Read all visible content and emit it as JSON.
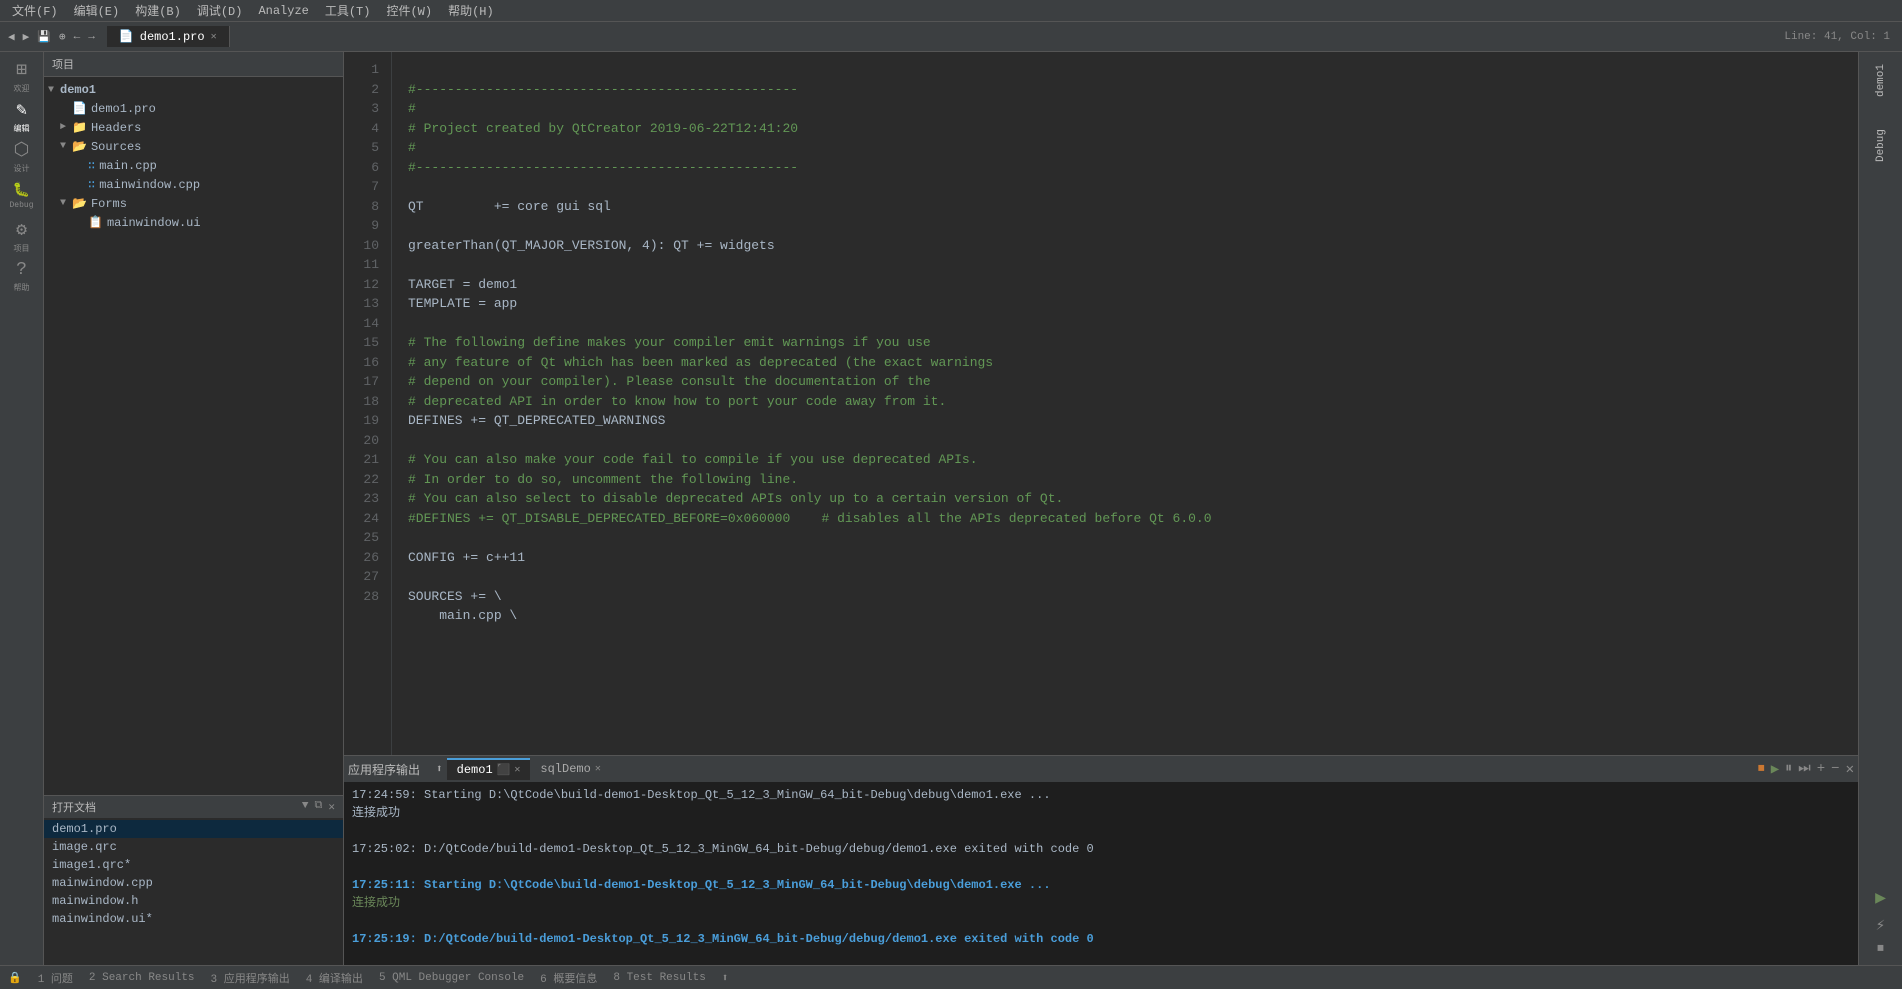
{
  "menuBar": {
    "items": [
      "文件(F)",
      "编辑(E)",
      "构建(B)",
      "调试(D)",
      "Analyze",
      "工具(T)",
      "控件(W)",
      "帮助(H)"
    ]
  },
  "toolbar": {
    "lineCol": "Line: 41, Col: 1"
  },
  "activeTab": {
    "name": "demo1.pro",
    "icon": "📄"
  },
  "projectPanel": {
    "title": "项目",
    "tree": [
      {
        "id": "demo1-root",
        "indent": 0,
        "arrow": "▼",
        "icon": "",
        "name": "demo1",
        "bold": true
      },
      {
        "id": "demo1-pro",
        "indent": 1,
        "arrow": "",
        "icon": "📄",
        "name": "demo1.pro"
      },
      {
        "id": "headers",
        "indent": 1,
        "arrow": "►",
        "icon": "",
        "name": "Headers"
      },
      {
        "id": "sources",
        "indent": 1,
        "arrow": "▼",
        "icon": "",
        "name": "Sources"
      },
      {
        "id": "main-cpp",
        "indent": 2,
        "arrow": "",
        "icon": "📄",
        "name": "main.cpp"
      },
      {
        "id": "mainwindow-cpp",
        "indent": 2,
        "arrow": "",
        "icon": "📄",
        "name": "mainwindow.cpp"
      },
      {
        "id": "forms",
        "indent": 1,
        "arrow": "▼",
        "icon": "",
        "name": "Forms"
      },
      {
        "id": "mainwindow-ui",
        "indent": 2,
        "arrow": "",
        "icon": "📄",
        "name": "mainwindow.ui"
      }
    ]
  },
  "leftSidebar": {
    "items": [
      {
        "id": "welcome",
        "shape": "⊞",
        "label": "欢迎"
      },
      {
        "id": "edit",
        "shape": "✎",
        "label": "编辑",
        "active": true
      },
      {
        "id": "design",
        "shape": "⬡",
        "label": "设计"
      },
      {
        "id": "debug",
        "shape": "🐛",
        "label": "Debug"
      },
      {
        "id": "project",
        "shape": "⚙",
        "label": "项目"
      },
      {
        "id": "help",
        "shape": "?",
        "label": "帮助"
      }
    ]
  },
  "openDocs": {
    "title": "打开文档",
    "items": [
      {
        "name": "demo1.pro"
      },
      {
        "name": "image.qrc"
      },
      {
        "name": "image1.qrc*"
      },
      {
        "name": "mainwindow.cpp"
      },
      {
        "name": "mainwindow.h"
      },
      {
        "name": "mainwindow.ui*"
      }
    ]
  },
  "miniSidebar": {
    "items": [
      {
        "id": "demo1-mini",
        "label": "demo1"
      },
      {
        "id": "debug-mini",
        "label": "Debug"
      }
    ]
  },
  "code": {
    "lines": [
      {
        "num": 1,
        "content": "#-------------------------------------------------",
        "class": "c-comment"
      },
      {
        "num": 2,
        "content": "#",
        "class": "c-comment"
      },
      {
        "num": 3,
        "content": "# Project created by QtCreator 2019-06-22T12:41:20",
        "class": "c-comment"
      },
      {
        "num": 4,
        "content": "#",
        "class": "c-comment"
      },
      {
        "num": 5,
        "content": "#-------------------------------------------------",
        "class": "c-comment"
      },
      {
        "num": 6,
        "content": "",
        "class": ""
      },
      {
        "num": 7,
        "content": "QT         += core gui sql",
        "class": "c-text"
      },
      {
        "num": 8,
        "content": "",
        "class": ""
      },
      {
        "num": 9,
        "content": "greaterThan(QT_MAJOR_VERSION, 4): QT += widgets",
        "class": "c-text"
      },
      {
        "num": 10,
        "content": "",
        "class": ""
      },
      {
        "num": 11,
        "content": "TARGET = demo1",
        "class": "c-text"
      },
      {
        "num": 12,
        "content": "TEMPLATE = app",
        "class": "c-text"
      },
      {
        "num": 13,
        "content": "",
        "class": ""
      },
      {
        "num": 14,
        "content": "# The following define makes your compiler emit warnings if you use",
        "class": "c-comment"
      },
      {
        "num": 15,
        "content": "# any feature of Qt which has been marked as deprecated (the exact warnings",
        "class": "c-comment"
      },
      {
        "num": 16,
        "content": "# depend on your compiler). Please consult the documentation of the",
        "class": "c-comment"
      },
      {
        "num": 17,
        "content": "# deprecated API in order to know how to port your code away from it.",
        "class": "c-comment"
      },
      {
        "num": 18,
        "content": "DEFINES += QT_DEPRECATED_WARNINGS",
        "class": "c-text"
      },
      {
        "num": 19,
        "content": "",
        "class": ""
      },
      {
        "num": 20,
        "content": "# You can also make your code fail to compile if you use deprecated APIs.",
        "class": "c-comment"
      },
      {
        "num": 21,
        "content": "# In order to do so, uncomment the following line.",
        "class": "c-comment"
      },
      {
        "num": 22,
        "content": "# You can also select to disable deprecated APIs only up to a certain version of Qt.",
        "class": "c-comment"
      },
      {
        "num": 23,
        "content": "#DEFINES += QT_DISABLE_DEPRECATED_BEFORE=0x060000    # disables all the APIs deprecated before Qt 6.0.0",
        "class": "c-comment"
      },
      {
        "num": 24,
        "content": "",
        "class": ""
      },
      {
        "num": 25,
        "content": "CONFIG += c++11",
        "class": "c-text"
      },
      {
        "num": 26,
        "content": "",
        "class": ""
      },
      {
        "num": 27,
        "content": "SOURCES += \\",
        "class": "c-text"
      },
      {
        "num": 28,
        "content": "    main.cpp \\",
        "class": "c-text"
      }
    ]
  },
  "bottomPanel": {
    "title": "应用程序输出",
    "tabs": [
      {
        "name": "demo1",
        "active": true,
        "hasClose": true
      },
      {
        "name": "sqlDemo",
        "active": false,
        "hasClose": true
      }
    ],
    "outputLines": [
      {
        "text": "17:24:59: Starting D:\\QtCode\\build-demo1-Desktop_Qt_5_12_3_MinGW_64_bit-Debug\\debug\\demo1.exe ...",
        "style": "normal"
      },
      {
        "text": "连接成功",
        "style": "normal"
      },
      {
        "text": "",
        "style": "normal"
      },
      {
        "text": "17:25:02: D:/QtCode/build-demo1-Desktop_Qt_5_12_3_MinGW_64_bit-Debug/debug/demo1.exe exited with code 0",
        "style": "normal"
      },
      {
        "text": "",
        "style": "normal"
      },
      {
        "text": "17:25:11: Starting D:\\QtCode\\build-demo1-Desktop_Qt_5_12_3_MinGW_64_bit-Debug\\debug\\demo1.exe ...",
        "style": "blue-bold"
      },
      {
        "text": "连接成功",
        "style": "green"
      },
      {
        "text": "",
        "style": "normal"
      },
      {
        "text": "17:25:19: D:/QtCode/build-demo1-Desktop_Qt_5_12_3_MinGW_64_bit-Debug/debug/demo1.exe exited with code 0",
        "style": "blue-bold"
      }
    ]
  },
  "statusBar": {
    "items": [
      {
        "id": "status-lock",
        "text": "🔒"
      },
      {
        "id": "status-issues",
        "text": "1 问题"
      },
      {
        "id": "status-search",
        "text": "2 Search Results"
      },
      {
        "id": "status-output",
        "text": "3 应用程序输出"
      },
      {
        "id": "status-compile",
        "text": "4 编译输出"
      },
      {
        "id": "status-qml",
        "text": "5 QML Debugger Console"
      },
      {
        "id": "status-overview",
        "text": "6 概要信息"
      },
      {
        "id": "status-test",
        "text": "8 Test Results"
      },
      {
        "id": "status-arrow",
        "text": "⬆"
      }
    ]
  }
}
